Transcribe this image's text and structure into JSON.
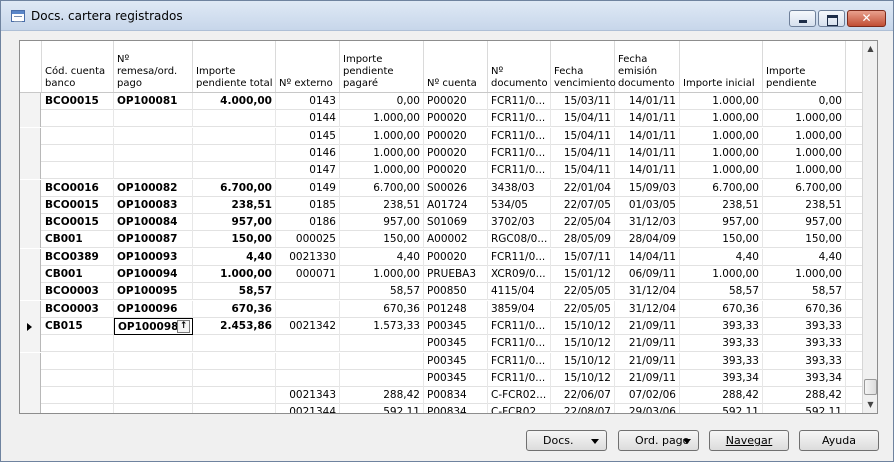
{
  "window": {
    "title": "Docs. cartera registrados"
  },
  "columns": [
    {
      "label": "Cód. cuenta banco"
    },
    {
      "label": "Nº remesa/ord. pago"
    },
    {
      "label": "Importe pendiente total"
    },
    {
      "label": "Nº externo"
    },
    {
      "label": "Importe pendiente pagaré"
    },
    {
      "label": "Nº cuenta"
    },
    {
      "label": "Nº documento"
    },
    {
      "label": "Fecha vencimiento"
    },
    {
      "label": "Fecha emisión documento"
    },
    {
      "label": "Importe inicial"
    },
    {
      "label": "Importe pendiente"
    }
  ],
  "rows": [
    {
      "c": [
        "BCO0015",
        "OP100081",
        "4.000,00",
        "0143",
        "0,00",
        "P00020",
        "FCR11/0...",
        "15/03/11",
        "14/01/11",
        "1.000,00",
        "0,00"
      ]
    },
    {
      "c": [
        "",
        "",
        "",
        "0144",
        "1.000,00",
        "P00020",
        "FCR11/0...",
        "15/04/11",
        "14/01/11",
        "1.000,00",
        "1.000,00"
      ]
    },
    {
      "c": [
        "",
        "",
        "",
        "0145",
        "1.000,00",
        "P00020",
        "FCR11/0...",
        "15/04/11",
        "14/01/11",
        "1.000,00",
        "1.000,00"
      ]
    },
    {
      "c": [
        "",
        "",
        "",
        "0146",
        "1.000,00",
        "P00020",
        "FCR11/0...",
        "15/04/11",
        "14/01/11",
        "1.000,00",
        "1.000,00"
      ]
    },
    {
      "c": [
        "",
        "",
        "",
        "0147",
        "1.000,00",
        "P00020",
        "FCR11/0...",
        "15/04/11",
        "14/01/11",
        "1.000,00",
        "1.000,00"
      ]
    },
    {
      "c": [
        "BCO0016",
        "OP100082",
        "6.700,00",
        "0149",
        "6.700,00",
        "S00026",
        "3438/03",
        "22/01/04",
        "15/09/03",
        "6.700,00",
        "6.700,00"
      ]
    },
    {
      "c": [
        "BCO0015",
        "OP100083",
        "238,51",
        "0185",
        "238,51",
        "A01724",
        "534/05",
        "22/07/05",
        "01/03/05",
        "238,51",
        "238,51"
      ]
    },
    {
      "c": [
        "BCO0015",
        "OP100084",
        "957,00",
        "0186",
        "957,00",
        "S01069",
        "3702/03",
        "22/05/04",
        "31/12/03",
        "957,00",
        "957,00"
      ]
    },
    {
      "c": [
        "CB001",
        "OP100087",
        "150,00",
        "000025",
        "150,00",
        "A00002",
        "RGC08/0...",
        "28/05/09",
        "28/04/09",
        "150,00",
        "150,00"
      ]
    },
    {
      "c": [
        "BCO0389",
        "OP100093",
        "4,40",
        "0021330",
        "4,40",
        "P00020",
        "FCR11/0...",
        "15/07/11",
        "14/04/11",
        "4,40",
        "4,40"
      ]
    },
    {
      "c": [
        "CB001",
        "OP100094",
        "1.000,00",
        "000071",
        "1.000,00",
        "PRUEBA3",
        "XCR09/0...",
        "15/01/12",
        "06/09/11",
        "1.000,00",
        "1.000,00"
      ]
    },
    {
      "c": [
        "BCO0003",
        "OP100095",
        "58,57",
        "",
        "58,57",
        "P00850",
        "4115/04",
        "22/05/05",
        "31/12/04",
        "58,57",
        "58,57"
      ]
    },
    {
      "c": [
        "BCO0003",
        "OP100096",
        "670,36",
        "",
        "670,36",
        "P01248",
        "3859/04",
        "22/05/05",
        "31/12/04",
        "670,36",
        "670,36"
      ]
    },
    {
      "c": [
        "CB015",
        "OP100098",
        "2.453,86",
        "0021342",
        "1.573,33",
        "P00345",
        "FCR11/0...",
        "15/10/12",
        "21/09/11",
        "393,33",
        "393,33"
      ],
      "current": true
    },
    {
      "c": [
        "",
        "",
        "",
        "",
        "",
        "P00345",
        "FCR11/0...",
        "15/10/12",
        "21/09/11",
        "393,33",
        "393,33"
      ]
    },
    {
      "c": [
        "",
        "",
        "",
        "",
        "",
        "P00345",
        "FCR11/0...",
        "15/10/12",
        "21/09/11",
        "393,33",
        "393,33"
      ]
    },
    {
      "c": [
        "",
        "",
        "",
        "",
        "",
        "P00345",
        "FCR11/0...",
        "15/10/12",
        "21/09/11",
        "393,34",
        "393,34"
      ]
    },
    {
      "c": [
        "",
        "",
        "",
        "0021343",
        "288,42",
        "P00834",
        "C-FCR02...",
        "22/06/07",
        "07/02/06",
        "288,42",
        "288,42"
      ]
    },
    {
      "c": [
        "",
        "",
        "",
        "0021344",
        "592,11",
        "P00834",
        "C-FCR02...",
        "22/08/07",
        "29/03/06",
        "592,11",
        "592,11"
      ]
    }
  ],
  "buttons": {
    "docs": "Docs.",
    "ord_pago": "Ord. pago",
    "navegar": "Navegar",
    "ayuda": "Ayuda"
  },
  "icons": {
    "app": "table-icon",
    "lookup": "up-arrow-icon"
  }
}
